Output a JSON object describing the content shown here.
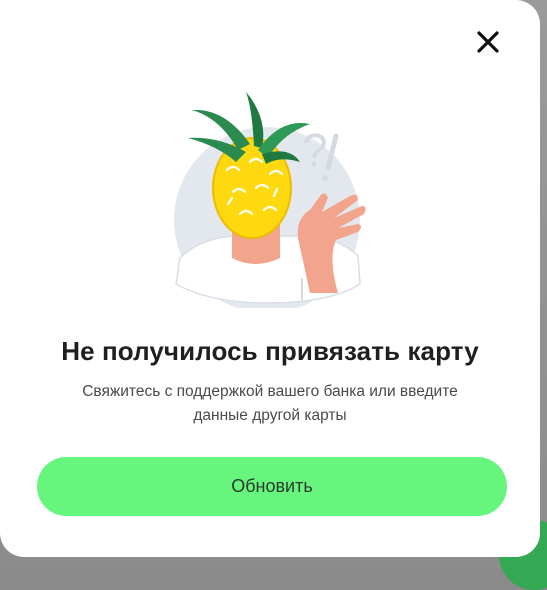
{
  "dialog": {
    "title": "Не получилось привязать карту",
    "message_line1": "Свяжитесь с поддержкой вашего банка или введите",
    "message_line2": "данные другой карты",
    "primary_button_label": "Обновить",
    "close_icon": "close-icon",
    "illustration": "pineapple-head-person-illustration"
  },
  "colors": {
    "button": "#66f57d",
    "title": "#1f1f1f",
    "text": "#4a4a4a",
    "background_accent": "#34a853"
  }
}
